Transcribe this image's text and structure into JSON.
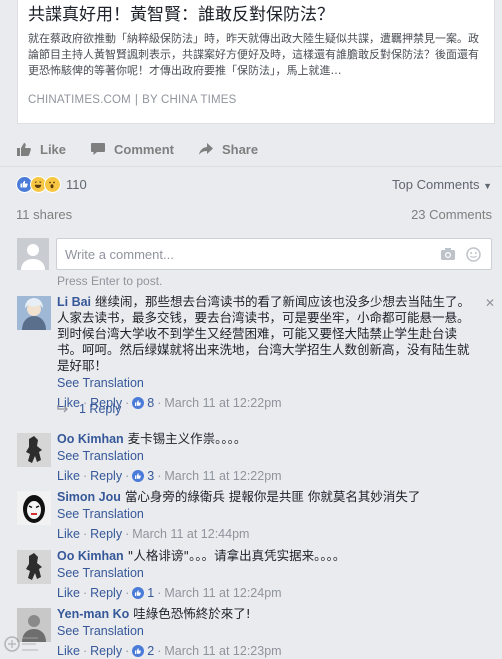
{
  "link_preview": {
    "title": "共諜真好用！黃智賢：誰敢反對保防法？",
    "description": "就在蔡政府欲推動「納粹級保防法」時，昨天就傳出政大陸生疑似共諜，遭羈押禁見一案。政論節目主持人黃智賢諷刺表示，共諜案好方便好及時，這樣還有誰膽敢反對保防法？後面還有更恐怖駭俾的等著你呢！才傳出政府要推「保防法」，馬上就進…",
    "source": "CHINATIMES.COM",
    "separator": "|",
    "byline": "BY CHINA TIMES"
  },
  "actions": {
    "like_label": "Like",
    "comment_label": "Comment",
    "share_label": "Share"
  },
  "reactions": {
    "count": "110",
    "sort_label": "Top Comments",
    "sort_icon": "caret-down-icon",
    "icons": [
      "like-reaction-icon",
      "haha-reaction-icon",
      "wow-reaction-icon"
    ]
  },
  "stats": {
    "shares": "11 shares",
    "comments": "23 Comments"
  },
  "comment_box": {
    "placeholder": "Write a comment...",
    "hint": "Press Enter to post."
  },
  "comments": [
    {
      "name": "Li Bai",
      "text": "继续闹，那些想去台湾读书的看了新闻应该也没多少想去当陆生了。人家去读书，最多交钱，要去台湾读书，可是要坐牢，小命都可能悬一悬。到时候台湾大学收不到学生又经营困难，可能又要怪大陆禁止学生赴台读书。呵呵。然后绿媒就将出来洗地，台湾大学招生人数创新高，没有陆生就是好耶！",
      "see_translation": "See Translation",
      "like": "Like",
      "reply": "Reply",
      "likes": "8",
      "time": "March 11 at 12:22pm"
    },
    {
      "name": "Oo Kimhan",
      "text": "麦卡锡主义作祟。。。。",
      "see_translation": "See Translation",
      "like": "Like",
      "reply": "Reply",
      "likes": "3",
      "time": "March 11 at 12:22pm"
    },
    {
      "name": "Simon Jou",
      "text": "當心身旁的綠衛兵 提報你是共匪 你就莫名其妙消失了",
      "see_translation": "See Translation",
      "like": "Like",
      "reply": "Reply",
      "likes": "",
      "time": "March 11 at 12:44pm"
    },
    {
      "name": "Oo Kimhan",
      "text": "\"人格诽谤\"。。。请拿出真凭实据来。。。。",
      "see_translation": "See Translation",
      "like": "Like",
      "reply": "Reply",
      "likes": "1",
      "time": "March 11 at 12:24pm"
    },
    {
      "name": "Yen-man Ko",
      "text": "哇綠色恐怖終於來了!",
      "see_translation": "See Translation",
      "like": "Like",
      "reply": "Reply",
      "likes": "2",
      "time": "March 11 at 12:23pm"
    }
  ],
  "replies": {
    "count_label": "1 Reply"
  },
  "colors": {
    "link_blue": "#365899",
    "meta_gray": "#90949c",
    "reaction_blue": "#4a7bd8",
    "background": "#e9ebee"
  }
}
